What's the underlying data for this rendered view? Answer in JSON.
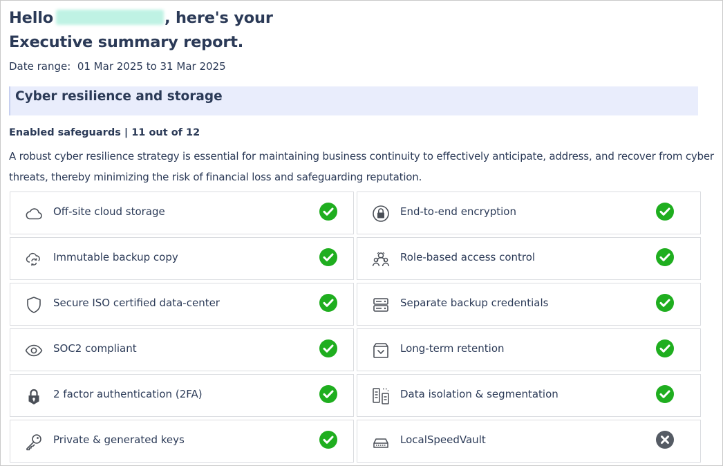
{
  "header": {
    "hello": "Hello",
    "rest": ", here's your",
    "line2": "Executive summary report."
  },
  "date_range": "Date range:  01 Mar 2025 to 31 Mar 2025",
  "section": {
    "title": "Cyber resilience and storage"
  },
  "safeguards": {
    "heading": "Enabled safeguards | 11 out of 12",
    "description": "A robust cyber resilience strategy is essential for maintaining business continuity to effectively anticipate, address, and recover from cyber threats, thereby minimizing the risk of financial loss and safeguarding reputation.",
    "items": [
      {
        "label": "Off-site cloud storage",
        "icon": "cloud-icon",
        "enabled": true
      },
      {
        "label": "End-to-end encryption",
        "icon": "lock-circle-icon",
        "enabled": true
      },
      {
        "label": "Immutable backup copy",
        "icon": "cloud-refresh-icon",
        "enabled": true
      },
      {
        "label": "Role-based access control",
        "icon": "users-icon",
        "enabled": true
      },
      {
        "label": "Secure ISO certified data-center",
        "icon": "shield-icon",
        "enabled": true
      },
      {
        "label": "Separate backup credentials",
        "icon": "server-icon",
        "enabled": true
      },
      {
        "label": "SOC2 compliant",
        "icon": "eye-icon",
        "enabled": true
      },
      {
        "label": "Long-term retention",
        "icon": "archive-icon",
        "enabled": true
      },
      {
        "label": "2 factor authentication (2FA)",
        "icon": "padlock-icon",
        "enabled": true
      },
      {
        "label": "Data isolation & segmentation",
        "icon": "segmentation-icon",
        "enabled": true
      },
      {
        "label": "Private & generated keys",
        "icon": "key-icon",
        "enabled": true
      },
      {
        "label": "LocalSpeedVault",
        "icon": "drive-icon",
        "enabled": false
      }
    ]
  },
  "colors": {
    "heading": "#2b3a57",
    "band": "#e9edfc",
    "check": "#1fae1f",
    "cross": "#555b64",
    "icon": "#4a4f57"
  }
}
